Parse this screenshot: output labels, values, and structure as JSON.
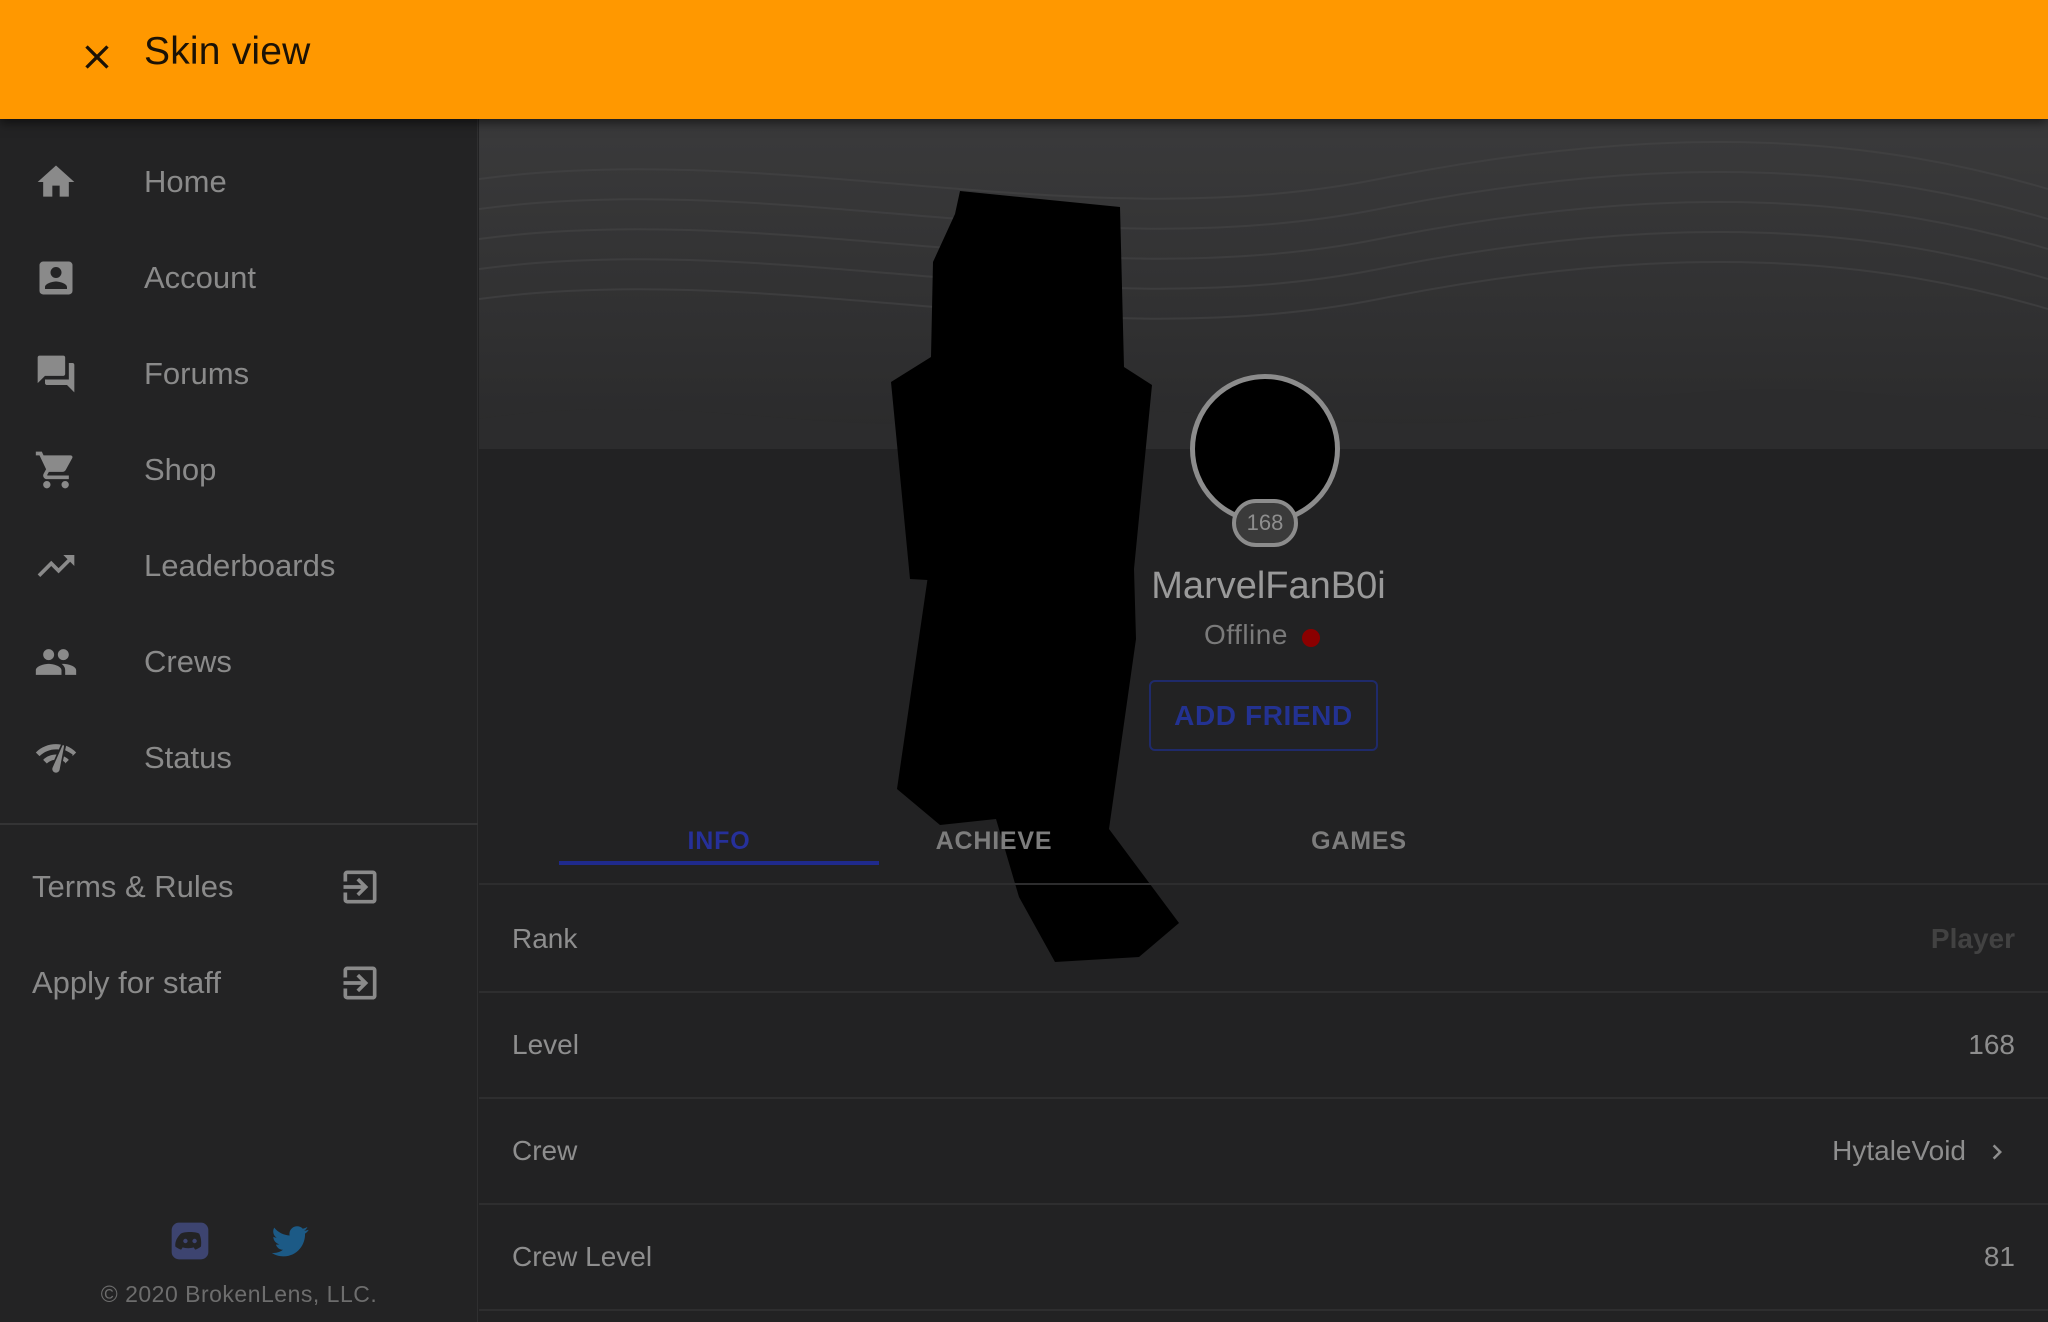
{
  "appbar": {
    "title": "Skin view",
    "close_icon": "close-icon",
    "color": "#ff9800"
  },
  "sidebar": {
    "items": [
      {
        "label": "Home",
        "icon": "home-icon"
      },
      {
        "label": "Account",
        "icon": "account-box-icon"
      },
      {
        "label": "Forums",
        "icon": "forum-icon"
      },
      {
        "label": "Shop",
        "icon": "cart-icon"
      },
      {
        "label": "Leaderboards",
        "icon": "trending-up-icon"
      },
      {
        "label": "Crews",
        "icon": "people-icon"
      },
      {
        "label": "Status",
        "icon": "network-check-icon"
      }
    ],
    "external_links": [
      {
        "label": "Terms & Rules",
        "icon": "exit-to-app-icon"
      },
      {
        "label": "Apply for staff",
        "icon": "exit-to-app-icon"
      }
    ],
    "social": [
      {
        "icon": "discord-icon"
      },
      {
        "icon": "twitter-icon"
      }
    ],
    "copyright": "© 2020 BrokenLens, LLC."
  },
  "profile": {
    "level_badge": "168",
    "username": "MarvelFanB0i",
    "status": "Offline",
    "status_color": "#8b0000",
    "add_friend_label": "ADD FRIEND"
  },
  "tabs": [
    {
      "label": "INFO",
      "active": true
    },
    {
      "label": "ACHIEVEMENTS",
      "visible_text": "ACHIEVE",
      "active": false
    },
    {
      "label": "GAMES",
      "active": false
    }
  ],
  "info_rows": [
    {
      "key": "Rank",
      "value": "Player"
    },
    {
      "key": "Level",
      "value": "168"
    },
    {
      "key": "Crew",
      "value": "HytaleVoid"
    },
    {
      "key": "Crew Level",
      "value": "81"
    }
  ]
}
